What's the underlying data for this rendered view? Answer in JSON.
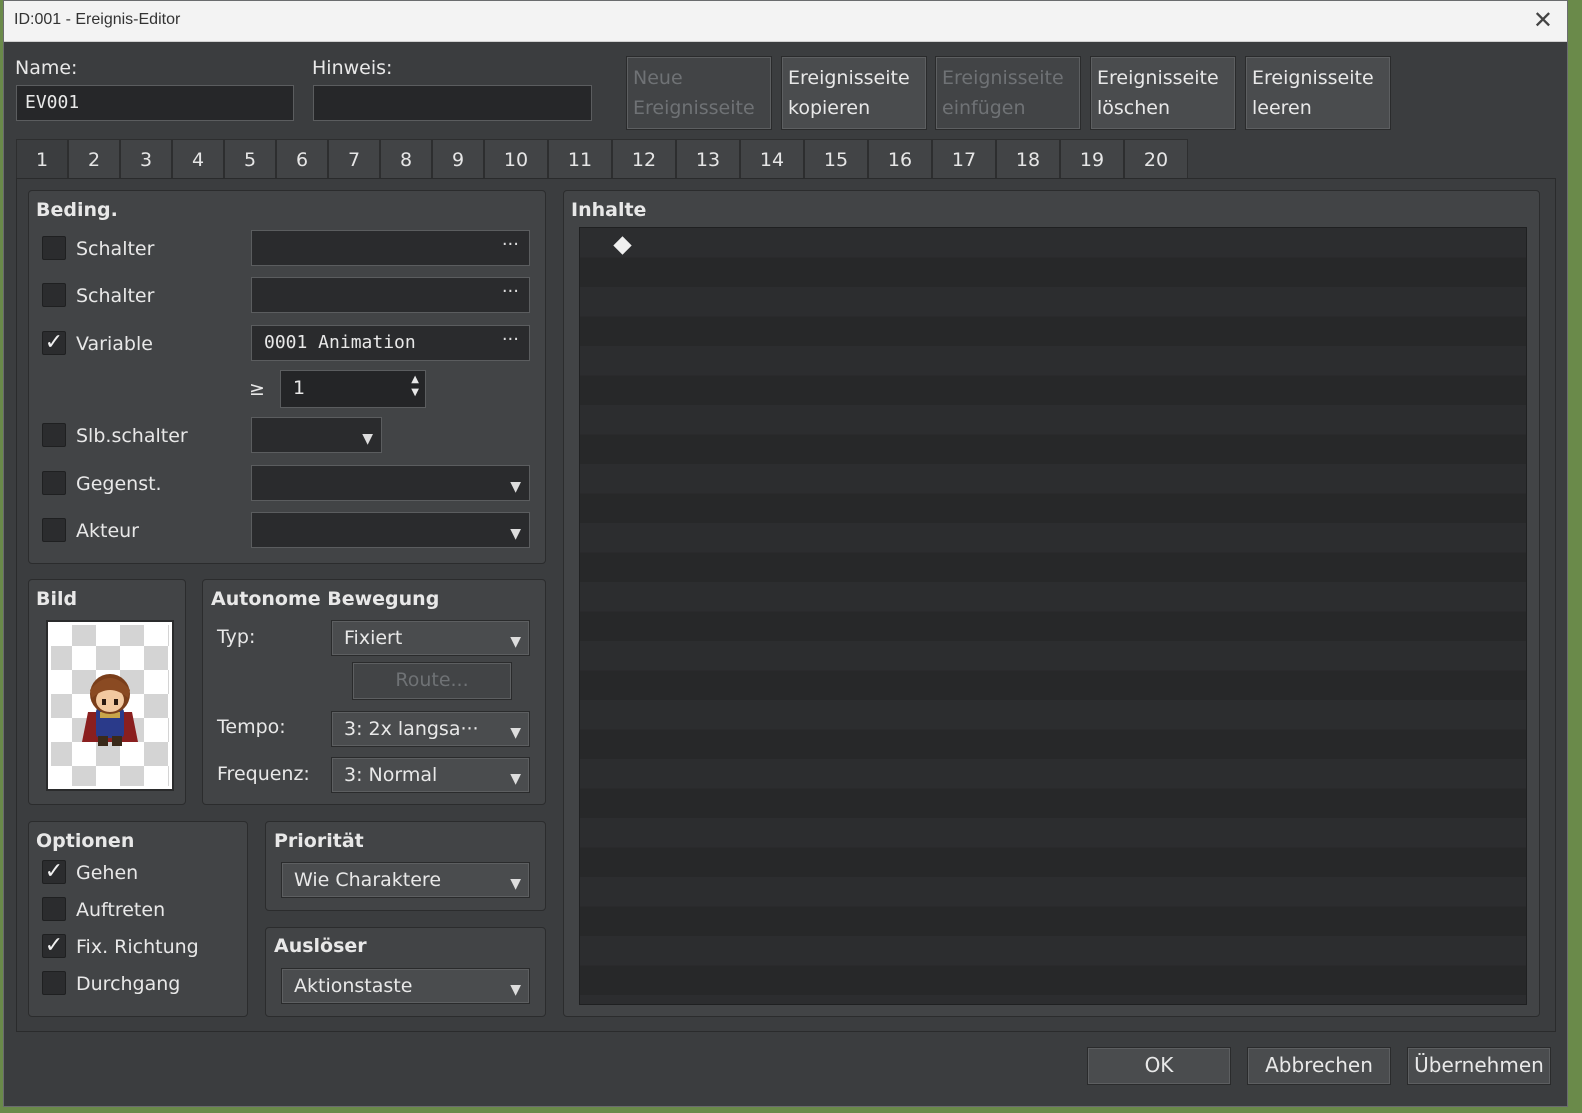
{
  "window": {
    "title": "ID:001 - Ereignis-Editor",
    "close_glyph": "✕"
  },
  "header": {
    "name_label": "Name:",
    "name_value": "EV001",
    "note_label": "Hinweis:",
    "note_value": "",
    "buttons": {
      "new_page": [
        "Neue",
        "Ereignisseite"
      ],
      "copy_page": [
        "Ereignisseite",
        "kopieren"
      ],
      "paste_page": [
        "Ereignisseite",
        "einfügen"
      ],
      "delete_page": [
        "Ereignisseite",
        "löschen"
      ],
      "clear_page": [
        "Ereignisseite",
        "leeren"
      ]
    }
  },
  "tabs": [
    "1",
    "2",
    "3",
    "4",
    "5",
    "6",
    "7",
    "8",
    "9",
    "10",
    "11",
    "12",
    "13",
    "14",
    "15",
    "16",
    "17",
    "18",
    "19",
    "20"
  ],
  "active_tab": "1",
  "conditions": {
    "title": "Beding.",
    "switch1": {
      "label": "Schalter",
      "checked": false,
      "value": "",
      "dots": "···"
    },
    "switch2": {
      "label": "Schalter",
      "checked": false,
      "value": "",
      "dots": "···"
    },
    "variable": {
      "label": "Variable",
      "checked": true,
      "value": "0001 Animation",
      "dots": "···",
      "operator": "≥",
      "compare_value": "1"
    },
    "self_switch": {
      "label": "Slb.schalter",
      "checked": false,
      "value": ""
    },
    "item": {
      "label": "Gegenst.",
      "checked": false,
      "value": ""
    },
    "actor": {
      "label": "Akteur",
      "checked": false,
      "value": ""
    }
  },
  "image": {
    "title": "Bild",
    "sprite": "character-sprite"
  },
  "movement": {
    "title": "Autonome Bewegung",
    "type_label": "Typ:",
    "type_value": "Fixiert",
    "route_button": "Route...",
    "speed_label": "Tempo:",
    "speed_value": "3: 2x langsa···",
    "freq_label": "Frequenz:",
    "freq_value": "3: Normal"
  },
  "options": {
    "title": "Optionen",
    "walking": {
      "label": "Gehen",
      "checked": true
    },
    "stepping": {
      "label": "Auftreten",
      "checked": false
    },
    "direction_fix": {
      "label": "Fix. Richtung",
      "checked": true
    },
    "through": {
      "label": "Durchgang",
      "checked": false
    }
  },
  "priority": {
    "title": "Priorität",
    "value": "Wie Charaktere"
  },
  "trigger": {
    "title": "Auslöser",
    "value": "Aktionstaste"
  },
  "contents": {
    "title": "Inhalte",
    "first_row_marker": "◆"
  },
  "footer": {
    "ok": "OK",
    "cancel": "Abbrechen",
    "apply": "Übernehmen"
  },
  "glyphs": {
    "check": "✓",
    "arrow_down": "▼",
    "spin_up": "▲",
    "spin_down": "▼"
  }
}
